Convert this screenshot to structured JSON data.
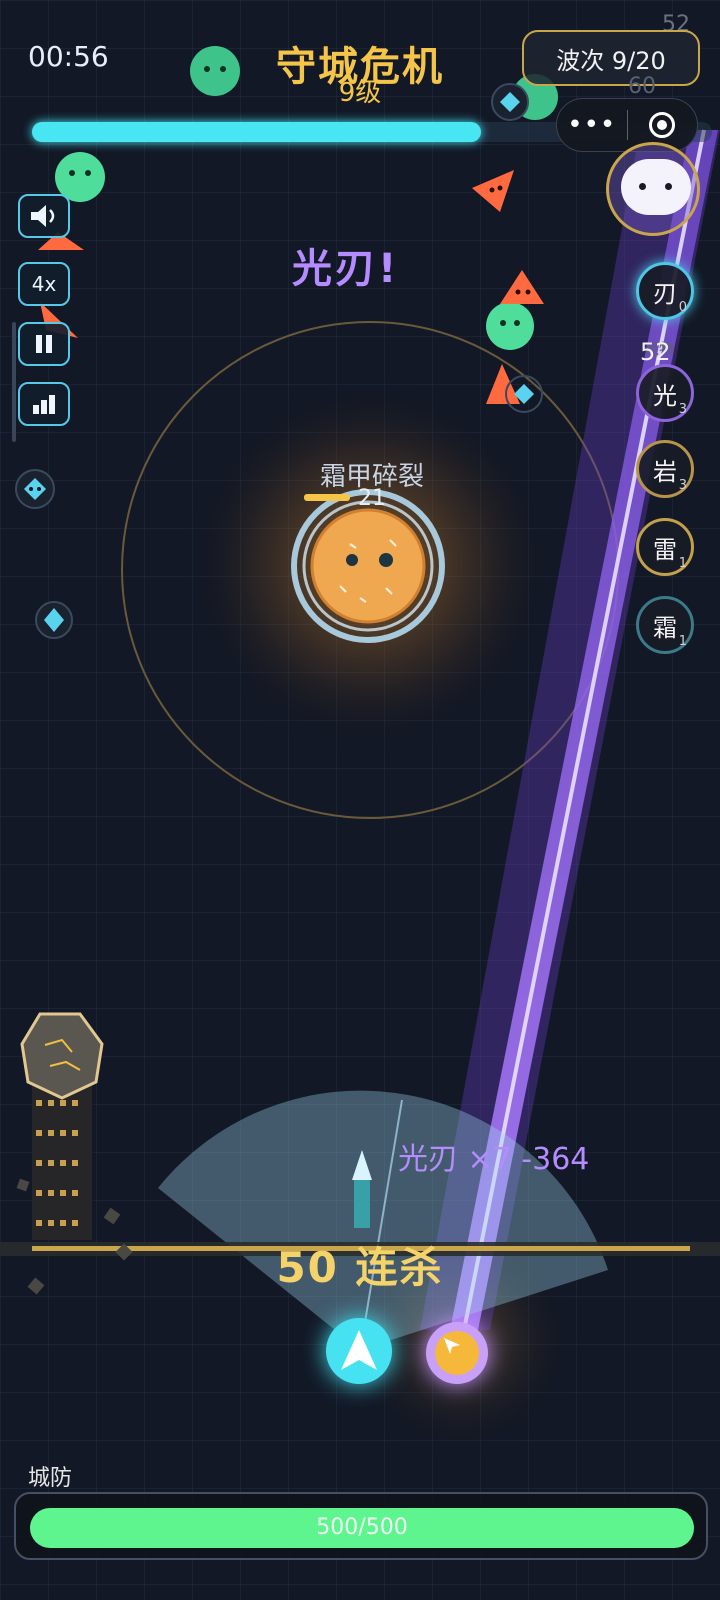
{
  "hud": {
    "timer": "00:56",
    "title": "守城危机",
    "level": "9级",
    "wave": "波次 9/20",
    "xp_progress": 0.66,
    "capsule_dots": "•••"
  },
  "controls": {
    "speed": "4x",
    "sound_icon": "speaker-icon",
    "pause_icon": "pause-icon",
    "stats_icon": "bar-chart-icon"
  },
  "skills": [
    {
      "label": "刃",
      "level": "0",
      "color": "#4ec6e6"
    },
    {
      "label": "光",
      "level": "3",
      "color": "#8c64dc"
    },
    {
      "label": "岩",
      "level": "3",
      "color": "#b8944a"
    },
    {
      "label": "雷",
      "level": "1",
      "color": "#c2a14a"
    },
    {
      "label": "霜",
      "level": "1",
      "color": "#3c7a88"
    }
  ],
  "pet": {
    "label": "宠物",
    "count": "52"
  },
  "floating": {
    "skill_banner": "光刃!",
    "boss_name": "霜甲碎裂",
    "boss_number": "21",
    "damage": "光刃 ×7 -364",
    "combo": "50 连杀",
    "corner_top": "52",
    "corner_second": "60"
  },
  "city": {
    "label": "城防",
    "hp_text": "500/500",
    "hp_fraction": 1.0,
    "hp_color": "#5ef58f"
  },
  "colors": {
    "accent_gold": "#f5c54a",
    "cyan": "#47e6f2",
    "purple_beam": "#9c6cf2"
  }
}
